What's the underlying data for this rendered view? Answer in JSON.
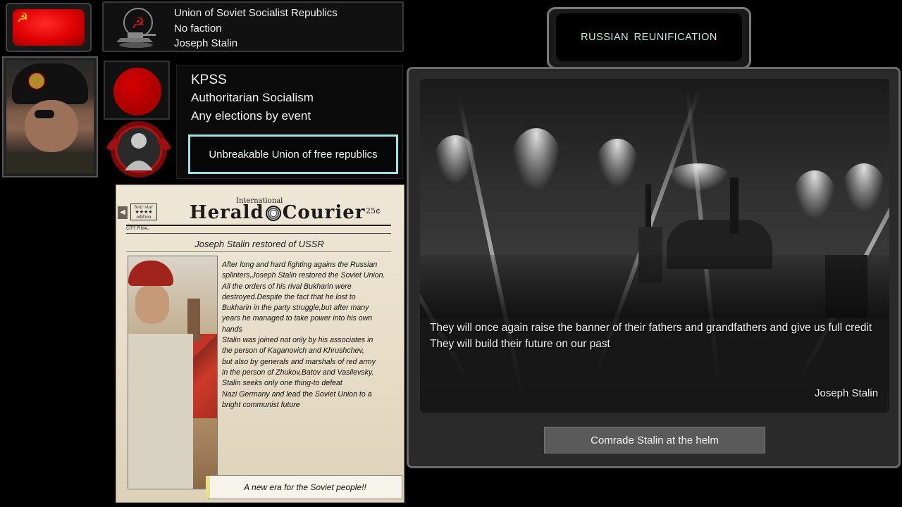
{
  "country": {
    "name": "Union of Soviet Socialist Republics",
    "faction": "No faction",
    "leader": "Joseph Stalin",
    "flag_color": "#e00000"
  },
  "party": {
    "name": "KPSS",
    "ideology": "Authoritarian Socialism",
    "elections": "Any elections by event",
    "motto": "Unbreakable Union of free republics",
    "ideology_color": "#c00000"
  },
  "newspaper": {
    "international": "International",
    "masthead_left": "Herald",
    "masthead_right": "Courier",
    "price": "25¢",
    "edition": [
      "four star",
      "★★★★",
      "edition"
    ],
    "city_final": "CITY FINAL",
    "headline": "Joseph Stalin restored of USSR",
    "body_lines": [
      "After long and hard fighting agains the Russian",
      "splinters,Joseph Stalin restored the Soviet Union.",
      "All the orders of his rival Bukharin were",
      "destroyed.Despite the fact that he lost to",
      "Bukharin in the party struggle,but after many",
      "years he managed to take power into his own",
      "hands",
      "Stalin was joined not only by his associates in",
      "the person of Kaganovich and Khrushchev,",
      "but also by generals and marshals of red army",
      "in the person of Zhukov,Batov and Vasilevsky.",
      "Stalin seeks only one thing-to defeat",
      "Nazi Germany and lead the Soviet Union to a",
      "bright communist future"
    ],
    "button": "A new era for the Soviet people!!"
  },
  "event": {
    "title": "RUSSIAN REUNIFICATION",
    "quote_lines": [
      "They will once again raise the banner of their fathers and grandfathers and give us full credit",
      "They will build their future on our past"
    ],
    "author": "Joseph Stalin",
    "option": "Comrade Stalin at the helm"
  },
  "icons": {
    "flag": "soviet-flag-icon",
    "emblem": "hammer-sickle-tank-emblem-icon",
    "ideology": "communism-circle-icon",
    "medal": "stalin-medal-icon"
  }
}
